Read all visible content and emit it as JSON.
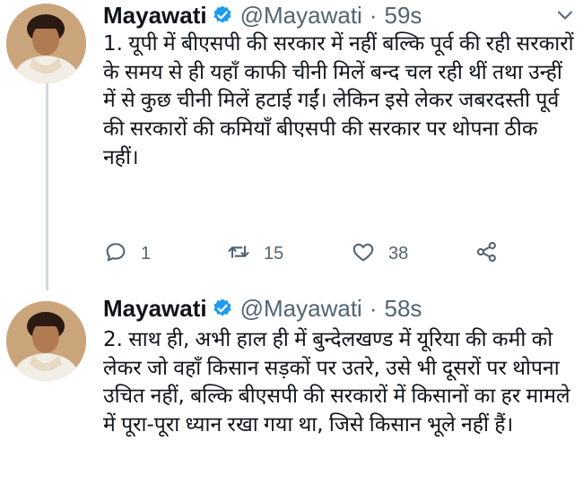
{
  "tweets": [
    {
      "author": {
        "name": "Mayawati",
        "handle": "@Mayawati"
      },
      "separator": "·",
      "time": "59s",
      "text": "1. यूपी में बीएसपी की सरकार में नहीं बल्कि पूर्व की रही सरकारों के समय से ही यहाँ काफी चीनी मिलें बन्द चल रही थीं तथा उन्हीं में से कुछ चीनी मिलें हटाई गईं। लेकिन इसे लेकर जबरदस्ती पूर्व की सरकारों की कमियाँ बीएसपी की सरकार पर थोपना ठीक नहीं।",
      "stats": {
        "replies": "1",
        "retweets": "15",
        "likes": "38"
      }
    },
    {
      "author": {
        "name": "Mayawati",
        "handle": "@Mayawati"
      },
      "separator": "·",
      "time": "58s",
      "text": "2. साथ ही, अभी हाल ही में बुन्देलखण्ड में यूरिया की कमी को लेकर जो वहाँ किसान सड़कों पर उतरे, उसे भी दूसरों पर थोपना उचित नहीं, बल्कि बीएसपी की सरकारों में किसानों का हर मामले में पूरा-पूरा ध्यान रखा गया था, जिसे किसान भूले नहीं हैं।"
    }
  ],
  "icons": {
    "verified": "verified-badge-icon",
    "more": "chevron-down-icon",
    "reply": "reply-icon",
    "retweet": "retweet-icon",
    "like": "heart-icon",
    "share": "share-icon"
  },
  "colors": {
    "verified_blue": "#1d9bf0",
    "secondary_text": "#536471",
    "thread_line": "#cfd9de"
  }
}
